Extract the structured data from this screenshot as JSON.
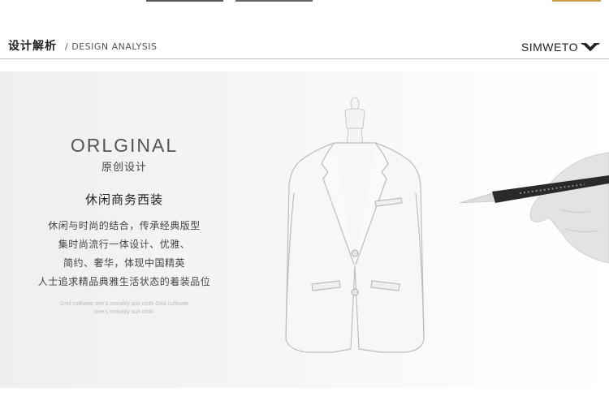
{
  "header": {
    "title_cn": "设计解析",
    "title_en": "/ DESIGN ANALYSIS",
    "brand": "SIMWETO"
  },
  "intro": {
    "title_en": "ORLGINAL",
    "title_cn": "原创设计",
    "heading": "休闲商务西装",
    "lines": [
      "休闲与时尚的结合，传承经典版型",
      "集时尚流行一体设计、优雅、",
      "简约、奢华，体现中国精英",
      "人士追求精品典雅生活状态的着装品位"
    ],
    "small_lines": [
      "Grid cultivate one's morality suit cloth Grid cultivate",
      "one's morality suit cloth"
    ]
  },
  "colors": {
    "rule": "#bdbdbd",
    "text": "#333333",
    "strip_dark": "#555555",
    "strip_gold": "#c89a4a"
  },
  "icons": {
    "brand_logo": "bowtie-logo-icon"
  }
}
